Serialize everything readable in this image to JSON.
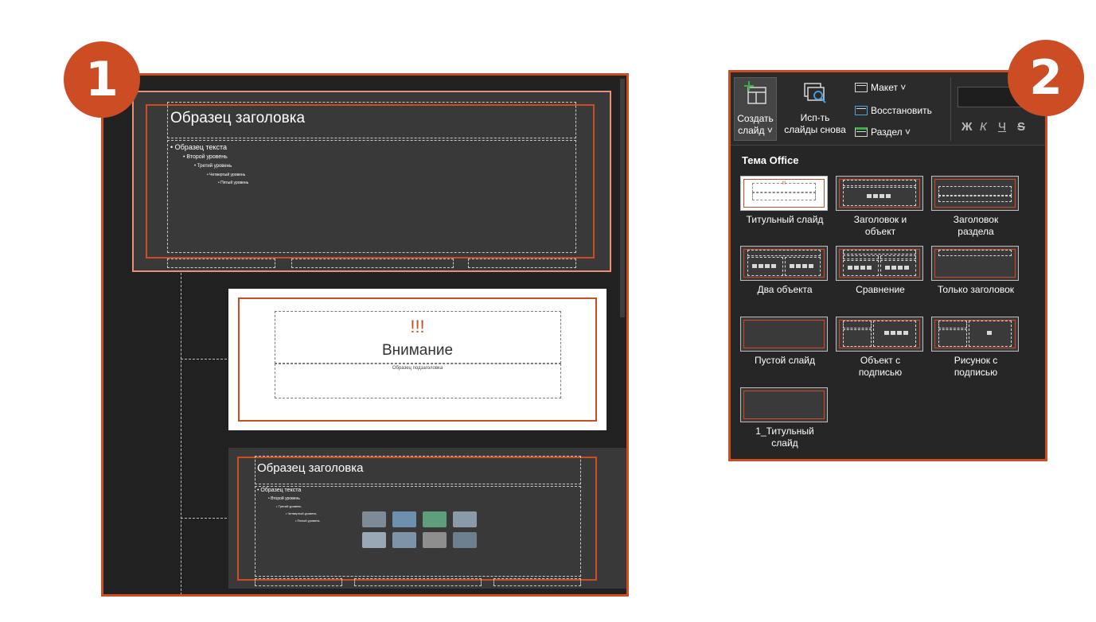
{
  "badges": {
    "one": "1",
    "two": "2"
  },
  "colors": {
    "accent": "#cc4c24",
    "dark_bg": "#212121",
    "slide_bg": "#393939"
  },
  "panel1": {
    "master_slide": {
      "title": "Образец заголовка",
      "levels": [
        "Образец текста",
        "Второй уровень",
        "Третий уровень",
        "Четвертый уровень",
        "Пятый уровень"
      ]
    },
    "title_slide": {
      "marks": "!!!",
      "title": "Внимание",
      "subtitle": "Образец подзаголовка"
    },
    "content_slide": {
      "title": "Образец заголовка",
      "levels": [
        "Образец текста",
        "Второй уровень",
        "Третий уровень",
        "Четвертый уровень",
        "Пятый уровень"
      ]
    }
  },
  "panel2": {
    "ribbon": {
      "new_slide": [
        "Создать",
        "слайд ˅"
      ],
      "reuse": [
        "Исп-ть",
        "слайды снова"
      ],
      "layout": "Макет ˅",
      "reset": "Восстановить",
      "section": "Раздел ˅",
      "format": [
        "Ж",
        "К",
        "Ч",
        "S"
      ]
    },
    "theme_title": "Тема Office",
    "layouts": [
      [
        "Титульный слайд"
      ],
      [
        "Заголовок и",
        "объект"
      ],
      [
        "Заголовок",
        "раздела"
      ],
      [
        "Два объекта"
      ],
      [
        "Сравнение"
      ],
      [
        "Только заголовок"
      ],
      [
        "Пустой слайд"
      ],
      [
        "Объект с",
        "подписью"
      ],
      [
        "Рисунок с",
        "подписью"
      ],
      [
        "1_Титульный",
        "слайд"
      ]
    ],
    "mini_title_marks": "!!!"
  }
}
